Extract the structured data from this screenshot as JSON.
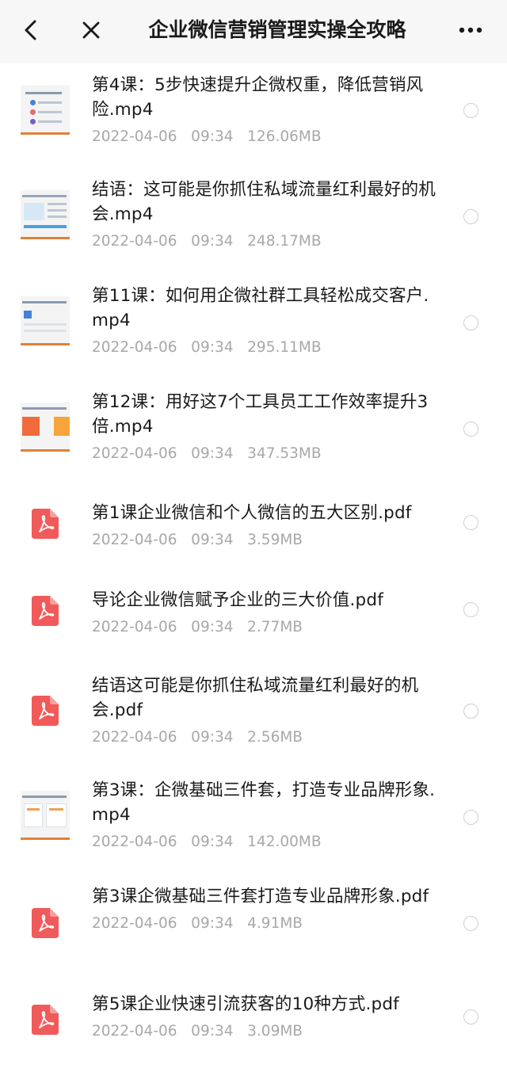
{
  "header": {
    "title": "企业微信营销管理实操全攻略"
  },
  "files": [
    {
      "name": "第4课：5步快速提升企微权重，降低营销风险.mp4",
      "date": "2022-04-06",
      "time": "09:34",
      "size": "126.06MB",
      "kind": "video"
    },
    {
      "name": "结语：这可能是你抓住私域流量红利最好的机会.mp4",
      "date": "2022-04-06",
      "time": "09:34",
      "size": "248.17MB",
      "kind": "video"
    },
    {
      "name": "第11课：如何用企微社群工具轻松成交客户.mp4",
      "date": "2022-04-06",
      "time": "09:34",
      "size": "295.11MB",
      "kind": "video"
    },
    {
      "name": "第12课：用好这7个工具员工工作效率提升3倍.mp4",
      "date": "2022-04-06",
      "time": "09:34",
      "size": "347.53MB",
      "kind": "video"
    },
    {
      "name": "第1课企业微信和个人微信的五大区别.pdf",
      "date": "2022-04-06",
      "time": "09:34",
      "size": "3.59MB",
      "kind": "pdf"
    },
    {
      "name": "导论企业微信赋予企业的三大价值.pdf",
      "date": "2022-04-06",
      "time": "09:34",
      "size": "2.77MB",
      "kind": "pdf"
    },
    {
      "name": "结语这可能是你抓住私域流量红利最好的机会.pdf",
      "date": "2022-04-06",
      "time": "09:34",
      "size": "2.56MB",
      "kind": "pdf"
    },
    {
      "name": "第3课：企微基础三件套，打造专业品牌形象.mp4",
      "date": "2022-04-06",
      "time": "09:34",
      "size": "142.00MB",
      "kind": "video"
    },
    {
      "name": "第3课企微基础三件套打造专业品牌形象.pdf",
      "date": "2022-04-06",
      "time": "09:34",
      "size": "4.91MB",
      "kind": "pdf"
    },
    {
      "name": "第5课企业快速引流获客的10种方式.pdf",
      "date": "2022-04-06",
      "time": "09:34",
      "size": "3.09MB",
      "kind": "pdf"
    }
  ],
  "icons": {
    "back": "chevron-left-icon",
    "close": "close-icon",
    "more": "more-horizontal-icon",
    "pdf": "pdf-file-icon",
    "radio": "radio-unselected-icon"
  },
  "colors": {
    "pdf_red": "#f15a5a",
    "thumb_accent": "#e0813a",
    "meta_gray": "#a8a8a8",
    "header_bg": "#f7f7f7"
  }
}
